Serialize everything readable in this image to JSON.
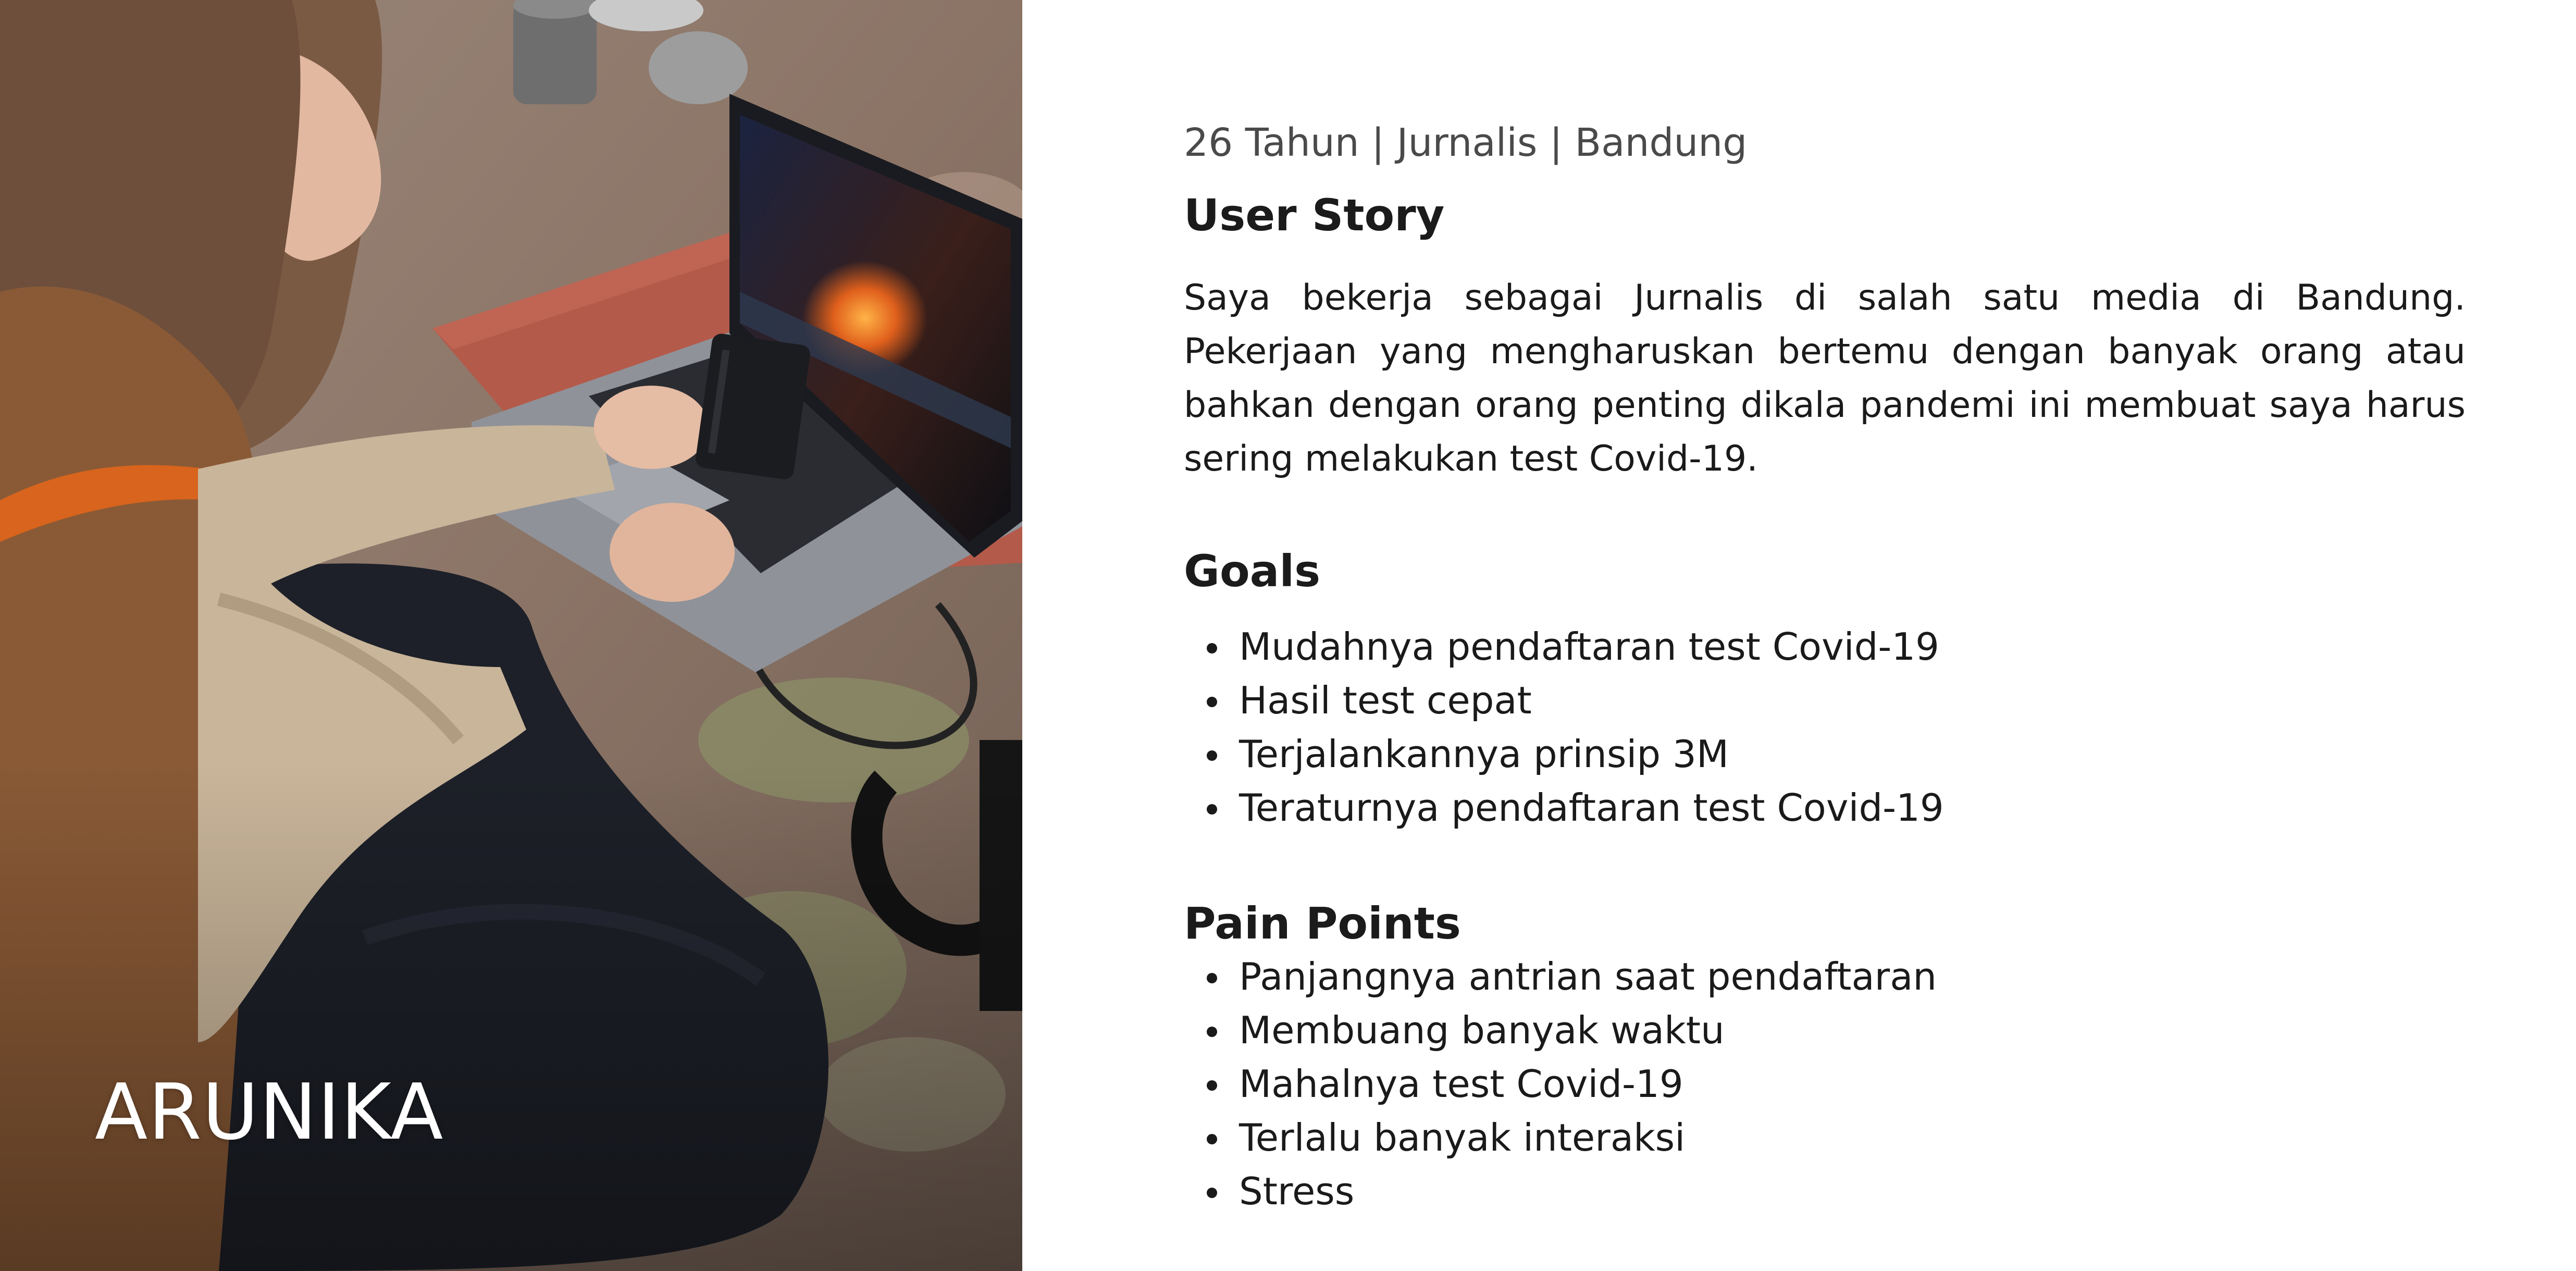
{
  "persona": {
    "name": "ARUNIKA",
    "meta": "26 Tahun | Jurnalis | Bandung"
  },
  "user_story": {
    "title": "User Story",
    "text": "Saya bekerja sebagai Jurnalis di salah satu media di Bandung. Pekerjaan yang mengharuskan bertemu dengan banyak orang atau bahkan dengan orang penting dikala pandemi ini membuat saya harus sering melakukan test Covid-19."
  },
  "goals": {
    "title": "Goals",
    "items": [
      "Mudahnya pendaftaran test Covid-19",
      "Hasil test cepat",
      "Terjalankannya prinsip 3M",
      "Teraturnya pendaftaran test Covid-19"
    ]
  },
  "pain_points": {
    "title": "Pain Points",
    "items": [
      "Panjangnya antrian saat pendaftaran",
      "Membuang banyak waktu",
      "Mahalnya test Covid-19",
      "Terlalu banyak interaksi",
      "Stress"
    ]
  },
  "photo": {
    "icon": "persona-photo",
    "colors": {
      "rock": "#8a7466",
      "sitting_pad": "#b45a4a",
      "jacket": "#8a5a36",
      "sleeve": "#c9b59a",
      "pants": "#1d2028",
      "laptop_body": "#8f9299",
      "laptop_screen": "#15161c",
      "ssd": "#1b1c20"
    }
  },
  "colors": {
    "background": "#ffffff",
    "heading": "#1b1b1b",
    "body_text": "#1a1a1a",
    "meta_text": "#4a4a4a"
  }
}
